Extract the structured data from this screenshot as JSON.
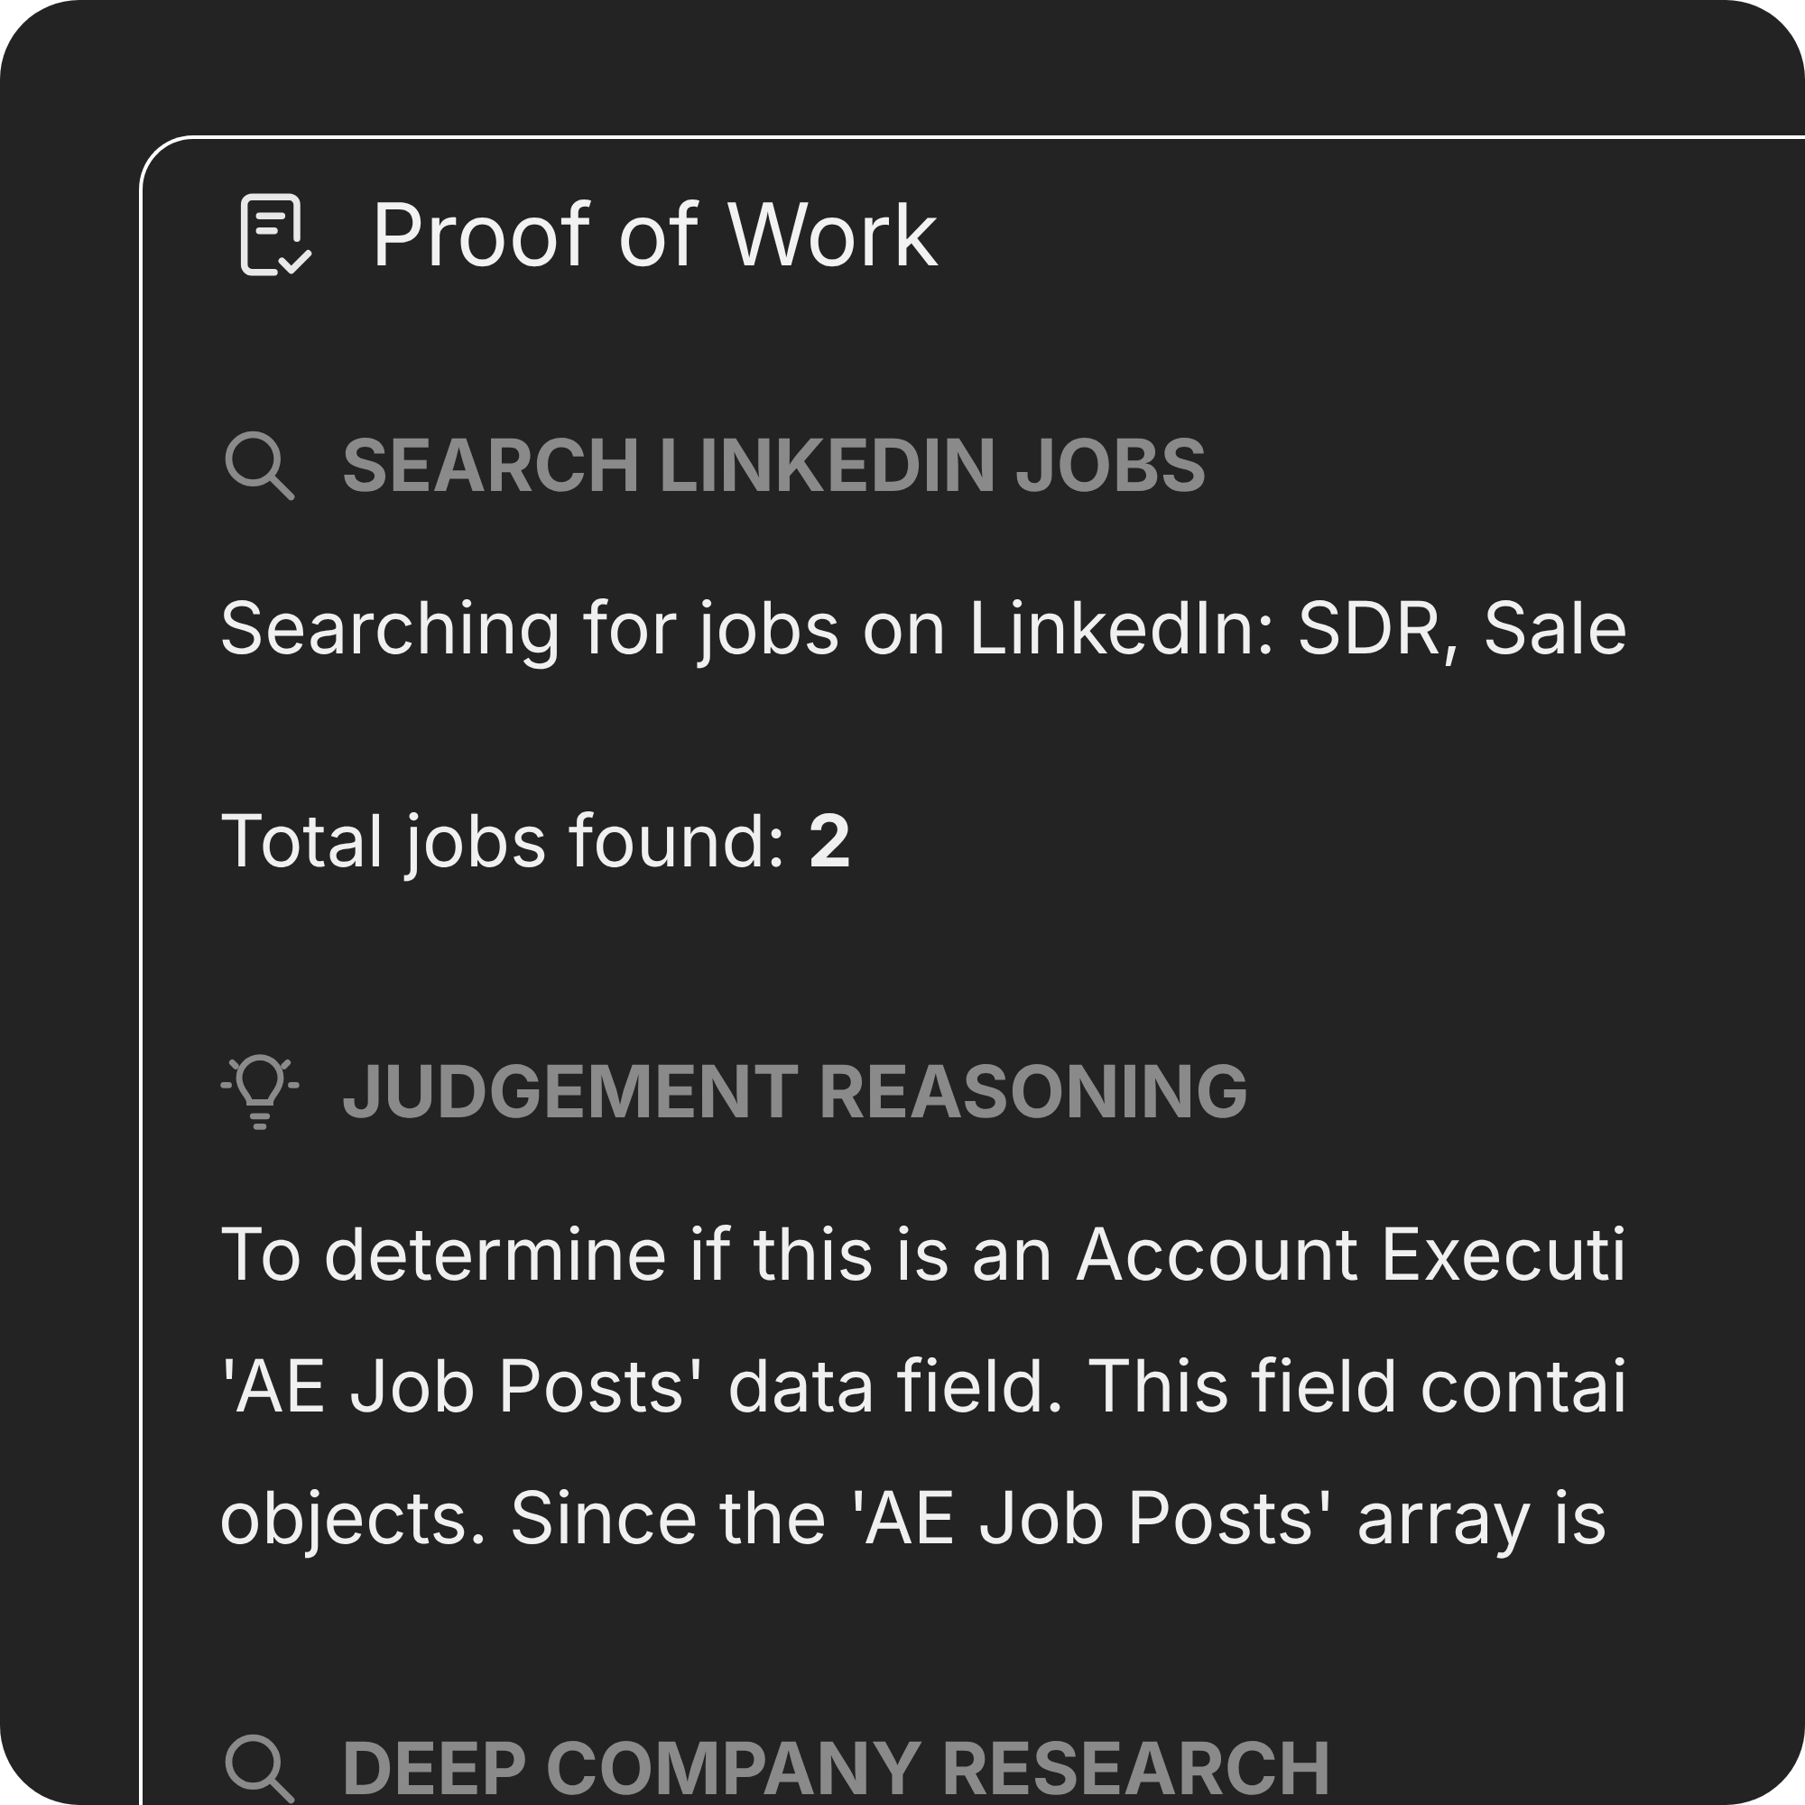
{
  "panel": {
    "title": "Proof of Work"
  },
  "sections": [
    {
      "kind": "search",
      "heading": "SEARCH LINKEDIN JOBS",
      "lines": [
        "Searching for jobs on LinkedIn: SDR, Sale"
      ],
      "paragraphs": [
        "Total jobs found: **2**"
      ]
    },
    {
      "kind": "idea",
      "heading": "JUDGEMENT REASONING",
      "lines": [
        "To determine if this is an Account Executi",
        "'AE Job Posts' data field. This field contai",
        "objects. Since the 'AE Job Posts' array is"
      ]
    },
    {
      "kind": "search",
      "heading": "DEEP COMPANY RESEARCH"
    }
  ]
}
